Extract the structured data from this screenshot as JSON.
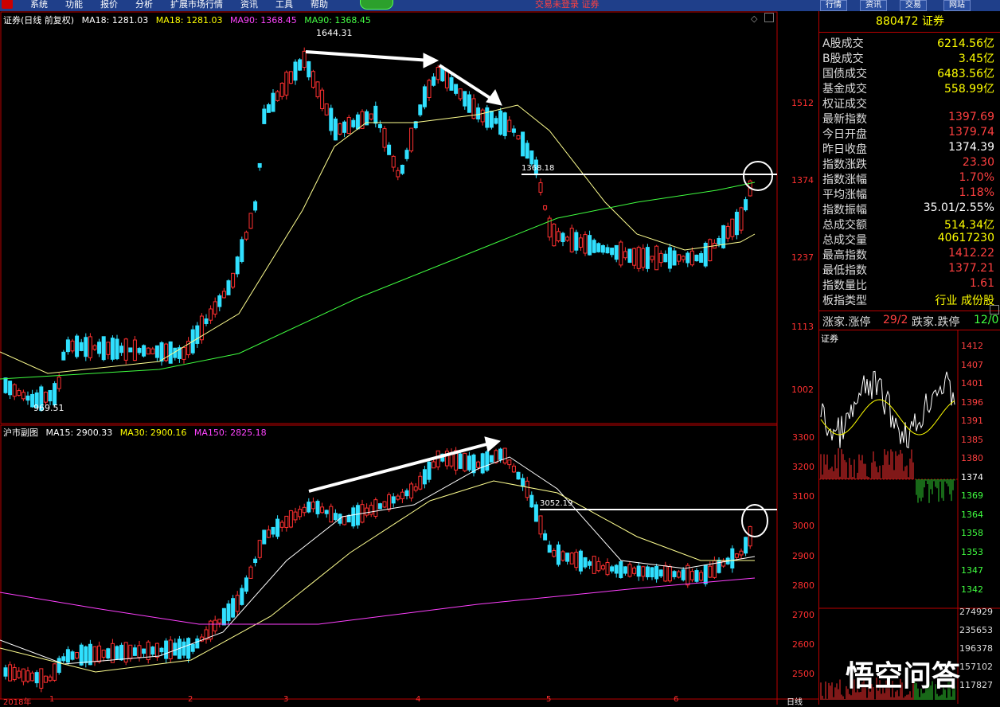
{
  "menu": [
    "系统",
    "功能",
    "报价",
    "分析",
    "扩展市场行情",
    "资讯",
    "工具",
    "帮助"
  ],
  "center_title": "交易未登录  证券",
  "right_buttons": [
    "行情",
    "资讯",
    "交易",
    "网站"
  ],
  "upper_chart": {
    "title": "证券(日线 前复权)",
    "ma_items": [
      {
        "label": "MA18: 1281.03",
        "color": "#ffffff"
      },
      {
        "label": "MA18: 1281.03",
        "color": "#ffff00"
      },
      {
        "label": "MA90: 1368.45",
        "color": "#ff40ff"
      },
      {
        "label": "MA90: 1368.45",
        "color": "#40ff40"
      }
    ],
    "y_ticks": [
      "1512",
      "1374",
      "1237",
      "1113",
      "1002"
    ],
    "high_label": "1644.31",
    "low_label": "969.51",
    "level_label": "1368.18"
  },
  "lower_chart": {
    "title": "沪市副图",
    "ma_items": [
      {
        "label": "MA15: 2900.33",
        "color": "#ffffff"
      },
      {
        "label": "MA30: 2900.16",
        "color": "#ffff00"
      },
      {
        "label": "MA150: 2825.18",
        "color": "#ff40ff"
      }
    ],
    "y_ticks": [
      "3300",
      "3200",
      "3100",
      "3000",
      "2900",
      "2800",
      "2700",
      "2600",
      "2500"
    ],
    "level_label": "3052.19"
  },
  "x_dates": [
    "2018年",
    "1",
    "2",
    "3",
    "4",
    "5",
    "6"
  ],
  "period_label": "日线",
  "quote": {
    "code": "880472",
    "name": "证券",
    "rows": [
      {
        "k": "A股成交",
        "v": "6214.56",
        "u": "亿",
        "c": "yellow"
      },
      {
        "k": "B股成交",
        "v": "3.45",
        "u": "亿",
        "c": "yellow"
      },
      {
        "k": "国债成交",
        "v": "6483.56",
        "u": "亿",
        "c": "yellow"
      },
      {
        "k": "基金成交",
        "v": "558.99",
        "u": "亿",
        "c": "yellow"
      },
      {
        "k": "权证成交",
        "v": "",
        "u": "",
        "c": "yellow"
      },
      {
        "k": "最新指数",
        "v": "1397.69",
        "u": "",
        "c": "red"
      },
      {
        "k": "今日开盘",
        "v": "1379.74",
        "u": "",
        "c": "red"
      },
      {
        "k": "昨日收盘",
        "v": "1374.39",
        "u": "",
        "c": "white"
      },
      {
        "k": "指数涨跌",
        "v": "23.30",
        "u": "",
        "c": "red"
      },
      {
        "k": "指数涨幅",
        "v": "1.70%",
        "u": "",
        "c": "red"
      },
      {
        "k": "平均涨幅",
        "v": "1.18%",
        "u": "",
        "c": "red"
      },
      {
        "k": "指数振幅",
        "v": "35.01/2.55%",
        "u": "",
        "c": "white"
      },
      {
        "k": "总成交额",
        "v": "514.34",
        "u": "亿",
        "c": "yellow"
      },
      {
        "k": "总成交量",
        "v": "40617230",
        "u": "",
        "c": "yellow"
      },
      {
        "k": "最高指数",
        "v": "1412.22",
        "u": "",
        "c": "red"
      },
      {
        "k": "最低指数",
        "v": "1377.21",
        "u": "",
        "c": "red"
      },
      {
        "k": "指数量比",
        "v": "1.61",
        "u": "",
        "c": "red"
      },
      {
        "k": "板指类型",
        "v": "行业 成份股",
        "u": "",
        "c": "yellow"
      }
    ],
    "breadth": {
      "up_label": "涨家.涨停",
      "up_value": "29/2",
      "down_label": "跌家.跌停",
      "down_value": "12/0"
    }
  },
  "mini_chart": {
    "title": "证券",
    "price_ticks": [
      "1412",
      "1407",
      "1401",
      "1396",
      "1391",
      "1385",
      "1380",
      "1374",
      "1369",
      "1364",
      "1358",
      "1353",
      "1347",
      "1342"
    ],
    "volume_ticks": [
      "274929",
      "235653",
      "196378",
      "157102",
      "117827"
    ]
  },
  "watermark": "悟空问答"
}
